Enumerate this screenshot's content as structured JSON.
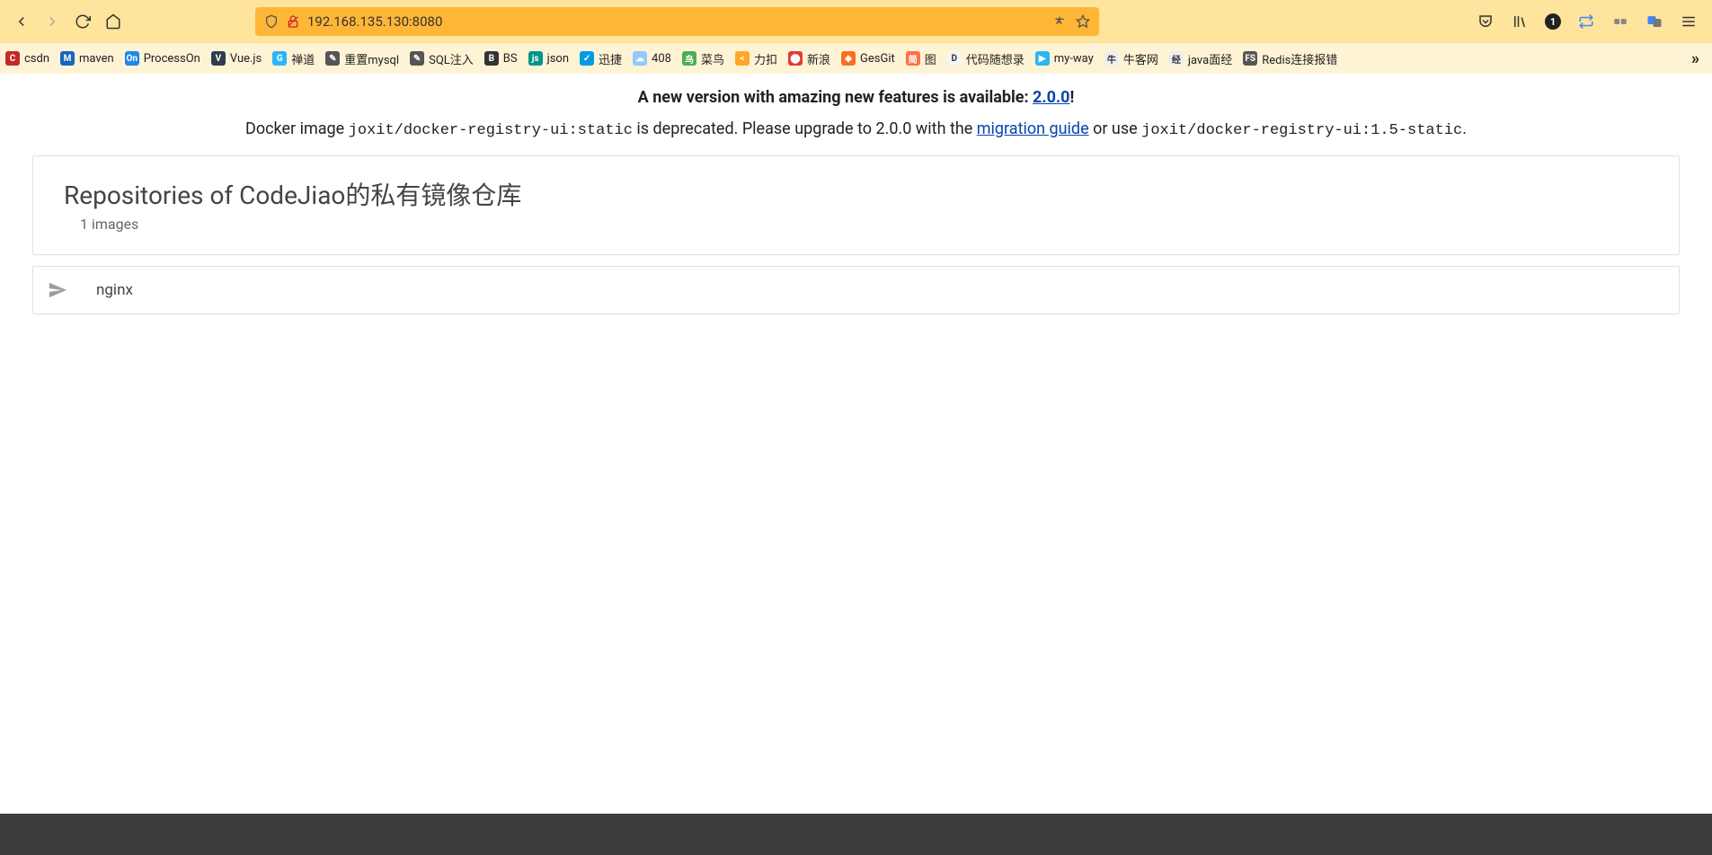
{
  "browser": {
    "url": "192.168.135.130:8080",
    "badge_count": "1"
  },
  "bookmarks": [
    {
      "label": "csdn",
      "favBg": "#c62828",
      "favText": "C"
    },
    {
      "label": "maven",
      "favBg": "#1565c0",
      "favText": "M"
    },
    {
      "label": "ProcessOn",
      "favBg": "#1e88e5",
      "favText": "On"
    },
    {
      "label": "Vue.js",
      "favBg": "#2c3e50",
      "favText": "V"
    },
    {
      "label": "禅道",
      "favBg": "#29b6f6",
      "favText": "G"
    },
    {
      "label": "重置mysql",
      "favBg": "#555",
      "favText": "✎"
    },
    {
      "label": "SQL注入",
      "favBg": "#555",
      "favText": "✎"
    },
    {
      "label": "BS",
      "favBg": "#333",
      "favText": "B"
    },
    {
      "label": "json",
      "favBg": "#009688",
      "favText": "js"
    },
    {
      "label": "迅捷",
      "favBg": "#039be5",
      "favText": "✓"
    },
    {
      "label": "408",
      "favBg": "#90caf9",
      "favText": "☁"
    },
    {
      "label": "菜鸟",
      "favBg": "#4caf50",
      "favText": "鸟"
    },
    {
      "label": "力扣",
      "favBg": "#ffa726",
      "favText": "<"
    },
    {
      "label": "新浪",
      "favBg": "#e53935",
      "favText": "⬤"
    },
    {
      "label": "GesGit",
      "favBg": "#fc6d26",
      "favText": "◆"
    },
    {
      "label": "图",
      "favBg": "#ff7043",
      "favText": "简"
    },
    {
      "label": "代码随想录",
      "favBg": "#f5f5f5",
      "favText": "D"
    },
    {
      "label": "my-way",
      "favBg": "#29b6f6",
      "favText": "▶"
    },
    {
      "label": "牛客网",
      "favBg": "#eee",
      "favText": "牛"
    },
    {
      "label": "java面经",
      "favBg": "#eee",
      "favText": "经"
    },
    {
      "label": "Redis连接报错",
      "favBg": "#555",
      "favText": "FS"
    }
  ],
  "notice": {
    "text": "A new version with amazing new features is available: ",
    "link_text": "2.0.0",
    "suffix": "!"
  },
  "deprecation": {
    "pre": "Docker image ",
    "img1": "joxit/docker-registry-ui:static",
    "mid": " is deprecated. Please upgrade to 2.0.0 with the ",
    "link": "migration guide",
    "post": " or use ",
    "img2": "joxit/docker-registry-ui:1.5-static",
    "end": "."
  },
  "repo_header": {
    "title": "Repositories of CodeJiao的私有镜像仓库",
    "count": "1 images"
  },
  "repos": [
    {
      "name": "nginx"
    }
  ]
}
